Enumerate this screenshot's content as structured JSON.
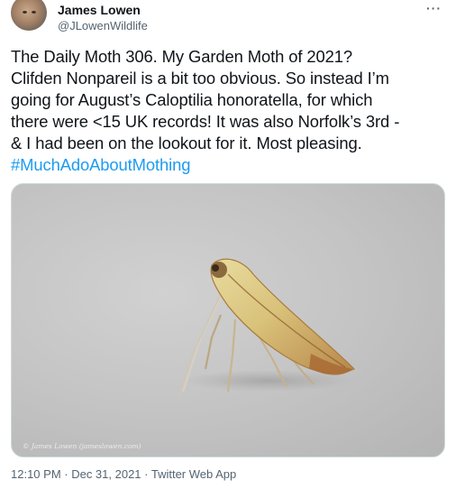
{
  "author": {
    "name": "James Lowen",
    "handle": "@JLowenWildlife",
    "avatar_icon": "user-avatar"
  },
  "more_icon": "ellipsis-icon",
  "tweet": {
    "lines": [
      "The Daily Moth 306. My Garden Moth of 2021?",
      "Clifden Nonpareil is a bit too obvious. So instead I’m",
      "going for August’s Caloptilia honoratella, for which",
      "there were <15 UK records! It was also Norfolk’s 3rd -",
      "& I had been on the lookout for it. Most pleasing."
    ],
    "hashtag": "#MuchAdoAboutMothing"
  },
  "media": {
    "credit": "© James Lowen (jameslowen.com)"
  },
  "meta": {
    "timestamp": "12:10 PM · Dec 31, 2021 · Twitter Web App"
  },
  "colors": {
    "link": "#1d9bf0",
    "secondary_text": "#536471",
    "primary_text": "#0f1419",
    "border": "#cfd9de"
  }
}
